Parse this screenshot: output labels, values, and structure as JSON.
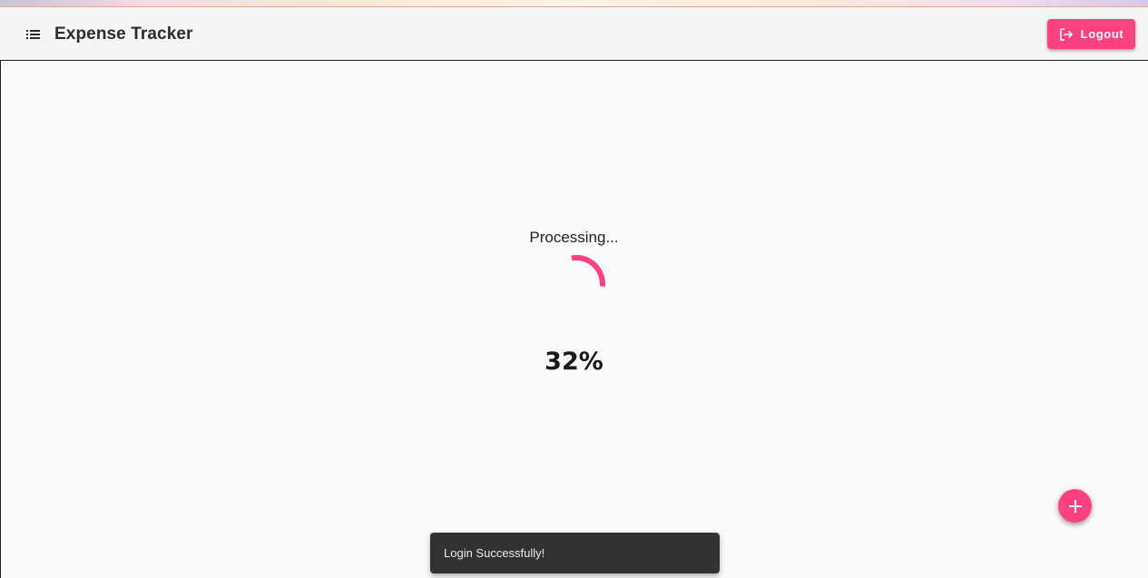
{
  "header": {
    "title": "Expense Tracker",
    "menu_icon": "list-icon",
    "logout_label": "Logout",
    "logout_icon": "logout-icon"
  },
  "main": {
    "status_text": "Processing...",
    "progress_percent_label": "32%",
    "progress_value": 32
  },
  "fab": {
    "icon": "plus-icon"
  },
  "snackbar": {
    "message": "Login Successfully!"
  },
  "colors": {
    "accent": "#ff4081",
    "snackbar_bg": "#323232",
    "toolbar_bg": "#f5f5f5",
    "page_bg": "#fafafa"
  }
}
